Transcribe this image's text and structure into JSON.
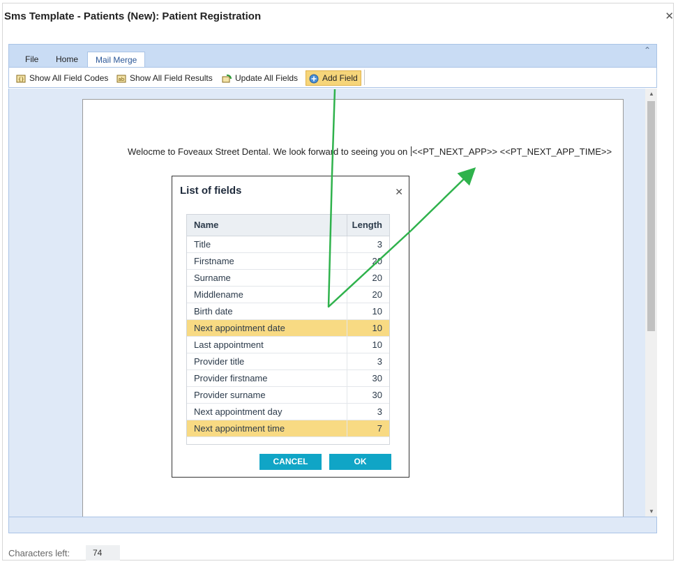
{
  "window": {
    "title": "Sms Template - Patients (New): Patient Registration",
    "close_icon": "close-icon"
  },
  "ribbon": {
    "tabs": [
      {
        "label": "File"
      },
      {
        "label": "Home"
      },
      {
        "label": "Mail Merge",
        "active": true
      }
    ],
    "toolbar": {
      "show_codes": "Show All Field Codes",
      "show_results": "Show All Field Results",
      "update_fields": "Update All Fields",
      "add_field": "Add Field"
    }
  },
  "document": {
    "text": "Welocme to Foveaux Street Dental. We look forward to seeing you on ",
    "fields": "<<PT_NEXT_APP>> <<PT_NEXT_APP_TIME>>"
  },
  "footer": {
    "chars_label": "Characters left:",
    "chars_value": "74"
  },
  "dialog": {
    "title": "List of fields",
    "columns": {
      "name": "Name",
      "length": "Length"
    },
    "rows": [
      {
        "name": "Title",
        "length": "3",
        "selected": false
      },
      {
        "name": "Firstname",
        "length": "20",
        "selected": false
      },
      {
        "name": "Surname",
        "length": "20",
        "selected": false
      },
      {
        "name": "Middlename",
        "length": "20",
        "selected": false
      },
      {
        "name": "Birth date",
        "length": "10",
        "selected": false
      },
      {
        "name": "Next appointment date",
        "length": "10",
        "selected": true
      },
      {
        "name": "Last appointment",
        "length": "10",
        "selected": false
      },
      {
        "name": "Provider title",
        "length": "3",
        "selected": false
      },
      {
        "name": "Provider firstname",
        "length": "30",
        "selected": false
      },
      {
        "name": "Provider surname",
        "length": "30",
        "selected": false
      },
      {
        "name": "Next appointment day",
        "length": "3",
        "selected": false
      },
      {
        "name": "Next appointment time",
        "length": "7",
        "selected": true
      }
    ],
    "cancel": "CANCEL",
    "ok": "OK"
  },
  "colors": {
    "highlight": "#f8da83",
    "button": "#10a5c6",
    "annotation": "#2fb24c"
  }
}
